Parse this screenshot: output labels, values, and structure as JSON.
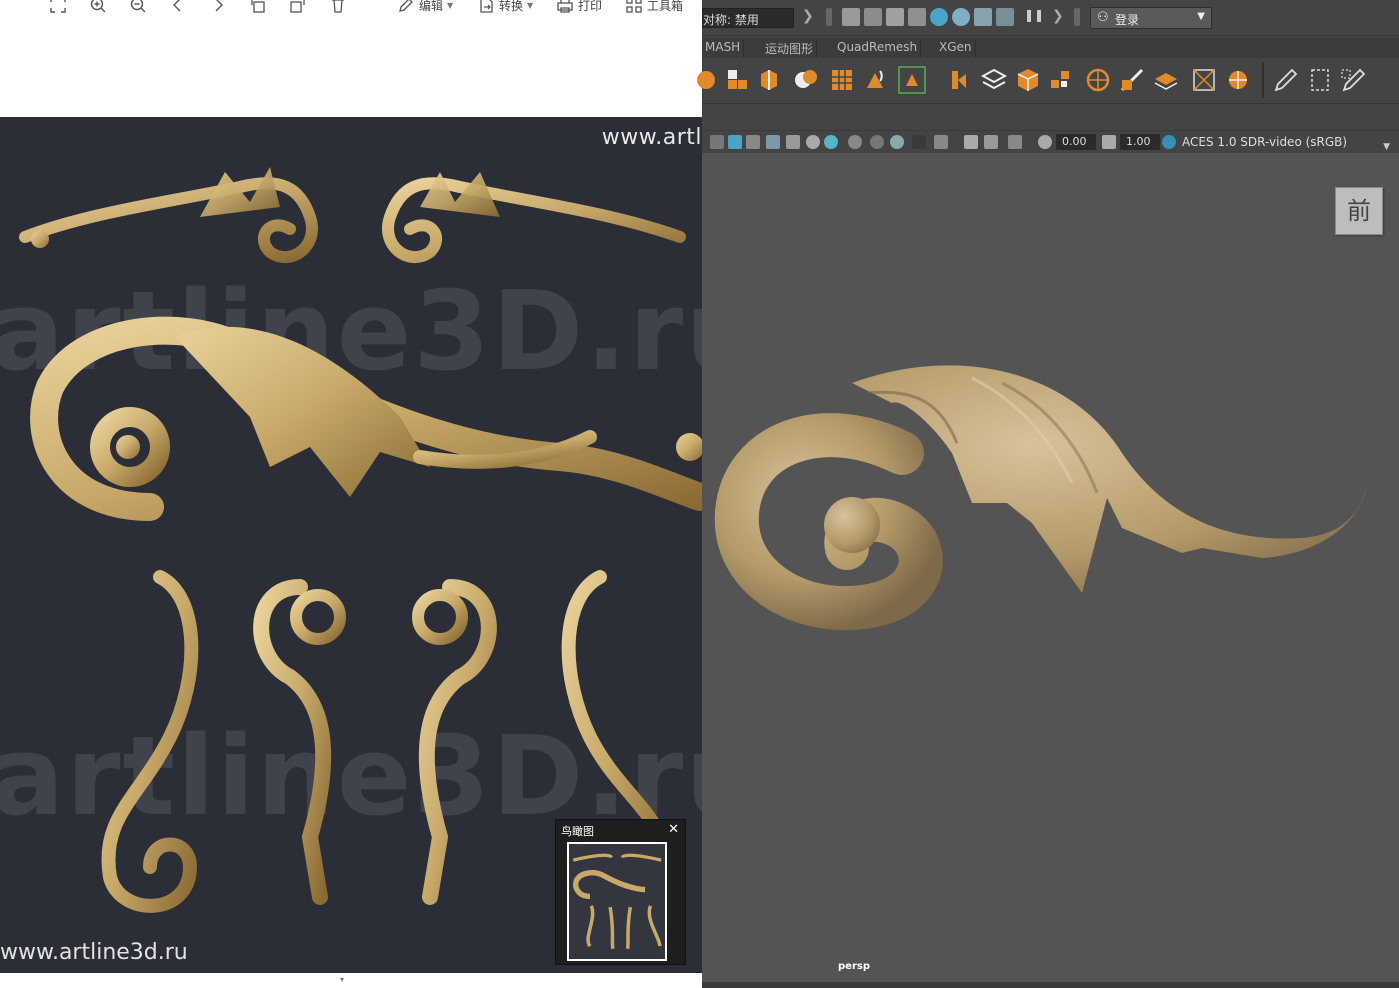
{
  "viewer": {
    "toolbar": {
      "edit_label": "编辑",
      "convert_label": "转换",
      "print_label": "打印",
      "toolbox_label": "工具箱",
      "icons": [
        "fit-screen-icon",
        "zoom-in-icon",
        "zoom-out-icon",
        "previous-icon",
        "next-icon",
        "rotate-left-icon",
        "rotate-right-icon",
        "delete-icon"
      ]
    },
    "image": {
      "watermark_top": "www.artl",
      "watermark_bottom": "www.artline3d.ru",
      "watermark_big_1": "artline3D.ru",
      "watermark_big_2": "artline3D.ru",
      "background_color": "#2b2e36",
      "ornament_color": "#c8a96a"
    },
    "birdseye": {
      "title": "鸟瞰图",
      "close_glyph": "✕"
    },
    "collapse_glyph": "▾"
  },
  "maya": {
    "status_line": {
      "symmetry_label": "对称: 禁用",
      "login_label": "登录"
    },
    "shelf_tabs": [
      "MASH",
      "运动图形",
      "QuadRemesh",
      "XGen"
    ],
    "panel_bar": {
      "exposure_value": "0.00",
      "gamma_value": "1.00",
      "color_space": "ACES 1.0 SDR-video (sRGB)"
    },
    "viewport": {
      "view_cube_label": "前",
      "camera_label": "persp",
      "background_color": "#545454",
      "model_color": "#b49a6a"
    }
  }
}
